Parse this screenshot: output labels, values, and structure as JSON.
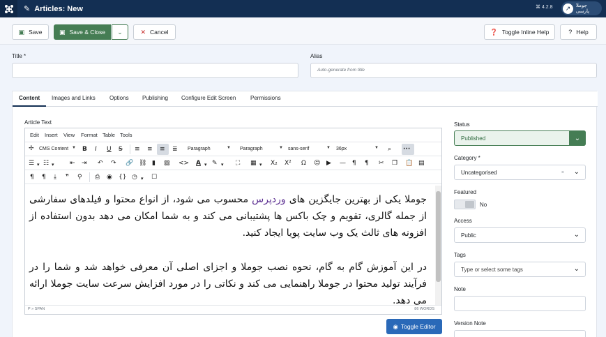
{
  "header": {
    "title": "Articles: New",
    "version": "⌘ 4.2.8",
    "user_label": "جوملا پارسی",
    "logo_icon": "joomla-icon",
    "title_icon": "pencil-icon"
  },
  "toolbar": {
    "save": "Save",
    "save_close": "Save & Close",
    "cancel": "Cancel",
    "toggle_inline_help": "Toggle Inline Help",
    "help": "Help"
  },
  "form": {
    "title_label": "Title *",
    "title_value": "",
    "alias_label": "Alias",
    "alias_placeholder": "Auto-generate from title"
  },
  "tabs": [
    "Content",
    "Images and Links",
    "Options",
    "Publishing",
    "Configure Edit Screen",
    "Permissions"
  ],
  "editor": {
    "label": "Article Text",
    "menu": [
      "Edit",
      "Insert",
      "View",
      "Format",
      "Table",
      "Tools"
    ],
    "cms_content": "CMS Content",
    "format_select": "Paragraph",
    "block_select": "Paragraph",
    "font_select": "sans-serif",
    "size_select": "36px",
    "paragraph1_a": "جوملا یکی از بهترین جایگزین های ",
    "paragraph1_link": "وردپرس",
    "paragraph1_b": " محسوب می شود، از انواع محتوا و فیلدهای سفارشی از جمله گالری، تقویم و چک باکس ها پشتیبانی می کند و به شما امکان می دهد بدون استفاده از افزونه های ثالث یک وب سایت پویا ایجاد کنید.",
    "paragraph2": "در این آموزش گام به گام، نحوه نصب جوملا و اجزای اصلی آن معرفی خواهد شد و شما را در فرآیند تولید محتوا در جوملا راهنمایی می کند و نکاتی را در مورد افزایش سرعت سایت جوملا ارائه می دهد.",
    "path": "P » SPAN",
    "word_count": "86 WORDS",
    "toggle_editor": "Toggle Editor"
  },
  "sidebar": {
    "status_label": "Status",
    "status_value": "Published",
    "category_label": "Category *",
    "category_value": "Uncategorised",
    "featured_label": "Featured",
    "featured_value": "No",
    "access_label": "Access",
    "access_value": "Public",
    "tags_label": "Tags",
    "tags_placeholder": "Type or select some tags",
    "note_label": "Note",
    "version_note_label": "Version Note"
  },
  "colors": {
    "header_bg": "#132f53",
    "success": "#457d54",
    "danger": "#c52827",
    "primary": "#2a69b8"
  }
}
